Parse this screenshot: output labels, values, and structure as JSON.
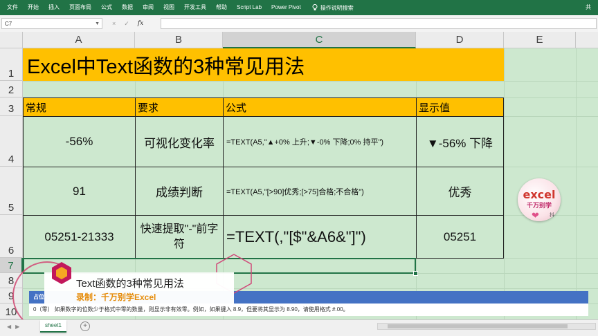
{
  "ribbon": {
    "tabs": [
      "文件",
      "开始",
      "插入",
      "页面布局",
      "公式",
      "数据",
      "审阅",
      "视图",
      "开发工具",
      "帮助",
      "Script Lab",
      "Power Pivot"
    ],
    "search_label": "操作说明搜索",
    "share_label": "共"
  },
  "formula_bar": {
    "name_box": "C7",
    "cancel": "×",
    "enter": "✓",
    "fx": "fx",
    "value": ""
  },
  "columns": [
    "A",
    "B",
    "C",
    "D",
    "E"
  ],
  "rows": [
    "1",
    "2",
    "3",
    "4",
    "5",
    "6",
    "7",
    "8",
    "9",
    "10"
  ],
  "sheet": {
    "title": "Excel中Text函数的3种常见用法",
    "header": [
      "常规",
      "要求",
      "公式",
      "显示值"
    ],
    "data": [
      [
        "-56%",
        "可视化变化率",
        "=TEXT(A5,\"▲+0% 上升;▼-0% 下降;0% 持平\")",
        "▼-56% 下降"
      ],
      [
        "91",
        "成绩判断",
        "=TEXT(A5,\"[>90]优秀;[>75]合格;不合格\")",
        "优秀"
      ],
      [
        "05251-21333",
        "快速提取\"-\"前字符",
        "=TEXT(,\"[$\"&A6&\"]\")",
        "05251"
      ]
    ]
  },
  "watermark": {
    "line1": "excel",
    "line2": "千万别学",
    "mark": "抖"
  },
  "overlay": {
    "title": "Text函数的3种常见用法",
    "subtitle": "录制：千万别学Excel"
  },
  "tooltip": {
    "label": "占位",
    "text": "0（零）    如果数字的位数少于格式中零的数量，则显示非有效零。例如，如果键入 8.9，但要将其显示为 8.90，请使用格式 #.00。"
  },
  "tabbar": {
    "sheet_name": "sheet1",
    "add": "+"
  },
  "colors": {
    "ribbon": "#217346",
    "sheet_fill": "#cde8cf",
    "title_fill": "#ffc000",
    "accent_orange": "#e58c0b",
    "tooltip_bar": "#4472c4"
  }
}
